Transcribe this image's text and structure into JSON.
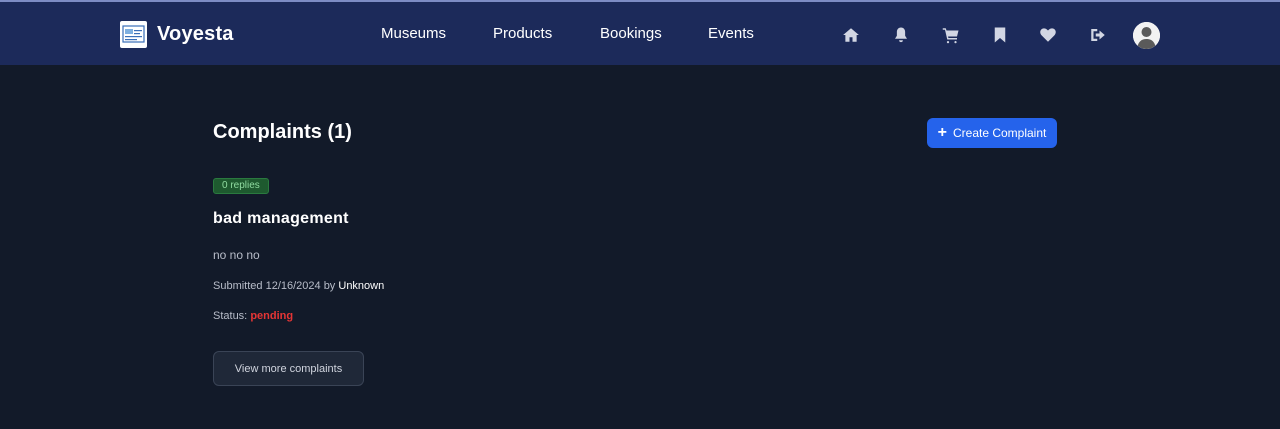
{
  "header": {
    "brand": "Voyesta",
    "nav": [
      {
        "label": "Museums"
      },
      {
        "label": "Products"
      },
      {
        "label": "Bookings"
      },
      {
        "label": "Events"
      }
    ],
    "icons": [
      "home-icon",
      "bell-icon",
      "cart-icon",
      "bookmark-icon",
      "heart-icon",
      "logout-icon",
      "avatar"
    ]
  },
  "main": {
    "title": "Complaints (1)",
    "create_button": {
      "icon": "+",
      "label": "Create Complaint"
    },
    "complaint": {
      "replies_badge": "0 replies",
      "title": "bad management",
      "body": "no no no",
      "submitted_prefix": "Submitted 12/16/2024 by",
      "author": "Unknown",
      "status_label": "Status:",
      "status_value": "pending"
    },
    "view_more_label": "View more complaints"
  },
  "colors": {
    "background": "#121a29",
    "header": "#1c2a5a",
    "accent": "#2563eb",
    "status_pending": "#e53535",
    "badge_bg": "#1e5a2f"
  }
}
